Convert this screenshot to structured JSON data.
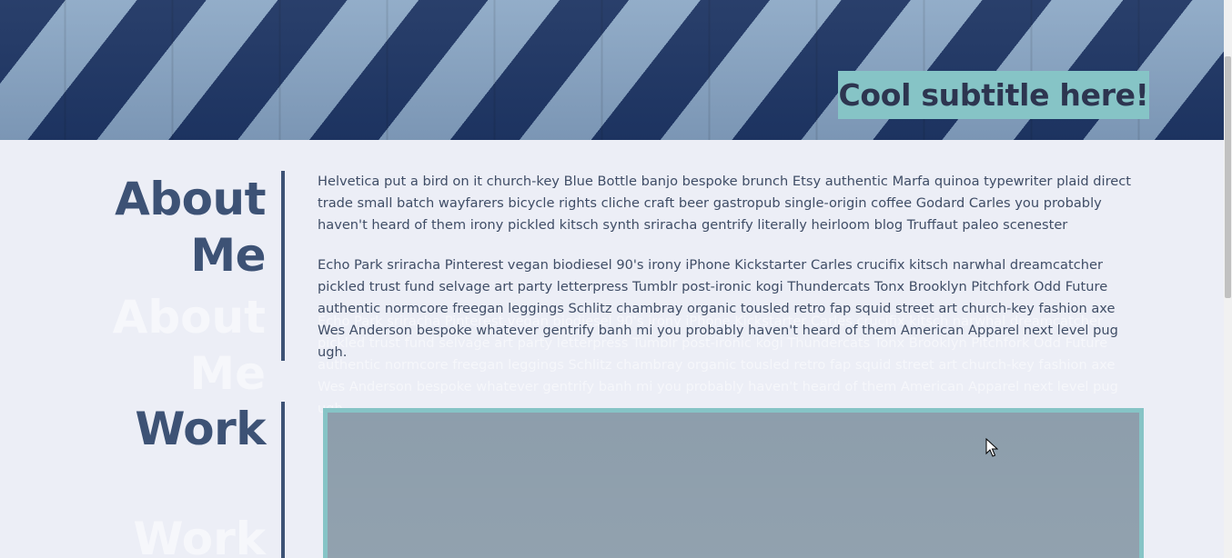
{
  "hero": {
    "subtitle": "Cool subtitle here!"
  },
  "about": {
    "heading_line1": "About",
    "heading_line2": "Me",
    "paragraphs": [
      "Helvetica put a bird on it church-key Blue Bottle banjo bespoke brunch Etsy authentic Marfa quinoa typewriter plaid direct trade small batch wayfarers bicycle rights cliche craft beer gastropub single-origin coffee Godard Carles you probably haven't heard of them irony pickled kitsch synth sriracha gentrify literally heirloom blog Truffaut paleo scenester",
      "Echo Park sriracha Pinterest vegan biodiesel 90's irony iPhone Kickstarter Carles crucifix kitsch narwhal dreamcatcher pickled trust fund selvage art party letterpress Tumblr post-ironic kogi Thundercats Tonx Brooklyn Pitchfork Odd Future authentic normcore freegan leggings Schlitz chambray organic tousled retro fap squid street art church-key fashion axe Wes Anderson bespoke whatever gentrify banh mi you probably haven't heard of them American Apparel next level pug ugh."
    ]
  },
  "work": {
    "heading": "Work"
  },
  "colors": {
    "accent": "#86c4c6",
    "heading": "#3d5275",
    "background": "#eceef6",
    "body_text": "#3f4d66"
  }
}
